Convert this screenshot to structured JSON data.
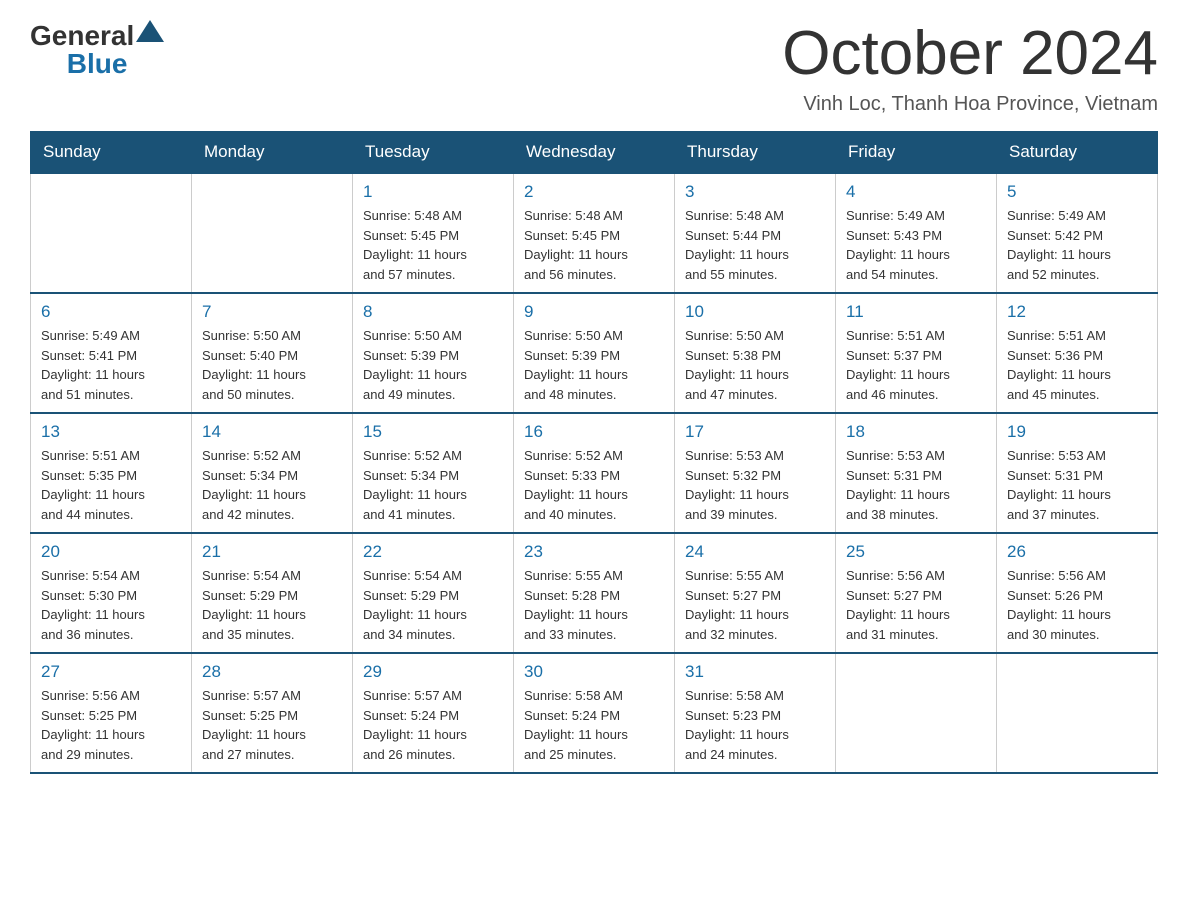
{
  "logo": {
    "general": "General",
    "blue": "Blue"
  },
  "title": "October 2024",
  "location": "Vinh Loc, Thanh Hoa Province, Vietnam",
  "headers": [
    "Sunday",
    "Monday",
    "Tuesday",
    "Wednesday",
    "Thursday",
    "Friday",
    "Saturday"
  ],
  "weeks": [
    [
      {
        "day": "",
        "info": ""
      },
      {
        "day": "",
        "info": ""
      },
      {
        "day": "1",
        "info": "Sunrise: 5:48 AM\nSunset: 5:45 PM\nDaylight: 11 hours\nand 57 minutes."
      },
      {
        "day": "2",
        "info": "Sunrise: 5:48 AM\nSunset: 5:45 PM\nDaylight: 11 hours\nand 56 minutes."
      },
      {
        "day": "3",
        "info": "Sunrise: 5:48 AM\nSunset: 5:44 PM\nDaylight: 11 hours\nand 55 minutes."
      },
      {
        "day": "4",
        "info": "Sunrise: 5:49 AM\nSunset: 5:43 PM\nDaylight: 11 hours\nand 54 minutes."
      },
      {
        "day": "5",
        "info": "Sunrise: 5:49 AM\nSunset: 5:42 PM\nDaylight: 11 hours\nand 52 minutes."
      }
    ],
    [
      {
        "day": "6",
        "info": "Sunrise: 5:49 AM\nSunset: 5:41 PM\nDaylight: 11 hours\nand 51 minutes."
      },
      {
        "day": "7",
        "info": "Sunrise: 5:50 AM\nSunset: 5:40 PM\nDaylight: 11 hours\nand 50 minutes."
      },
      {
        "day": "8",
        "info": "Sunrise: 5:50 AM\nSunset: 5:39 PM\nDaylight: 11 hours\nand 49 minutes."
      },
      {
        "day": "9",
        "info": "Sunrise: 5:50 AM\nSunset: 5:39 PM\nDaylight: 11 hours\nand 48 minutes."
      },
      {
        "day": "10",
        "info": "Sunrise: 5:50 AM\nSunset: 5:38 PM\nDaylight: 11 hours\nand 47 minutes."
      },
      {
        "day": "11",
        "info": "Sunrise: 5:51 AM\nSunset: 5:37 PM\nDaylight: 11 hours\nand 46 minutes."
      },
      {
        "day": "12",
        "info": "Sunrise: 5:51 AM\nSunset: 5:36 PM\nDaylight: 11 hours\nand 45 minutes."
      }
    ],
    [
      {
        "day": "13",
        "info": "Sunrise: 5:51 AM\nSunset: 5:35 PM\nDaylight: 11 hours\nand 44 minutes."
      },
      {
        "day": "14",
        "info": "Sunrise: 5:52 AM\nSunset: 5:34 PM\nDaylight: 11 hours\nand 42 minutes."
      },
      {
        "day": "15",
        "info": "Sunrise: 5:52 AM\nSunset: 5:34 PM\nDaylight: 11 hours\nand 41 minutes."
      },
      {
        "day": "16",
        "info": "Sunrise: 5:52 AM\nSunset: 5:33 PM\nDaylight: 11 hours\nand 40 minutes."
      },
      {
        "day": "17",
        "info": "Sunrise: 5:53 AM\nSunset: 5:32 PM\nDaylight: 11 hours\nand 39 minutes."
      },
      {
        "day": "18",
        "info": "Sunrise: 5:53 AM\nSunset: 5:31 PM\nDaylight: 11 hours\nand 38 minutes."
      },
      {
        "day": "19",
        "info": "Sunrise: 5:53 AM\nSunset: 5:31 PM\nDaylight: 11 hours\nand 37 minutes."
      }
    ],
    [
      {
        "day": "20",
        "info": "Sunrise: 5:54 AM\nSunset: 5:30 PM\nDaylight: 11 hours\nand 36 minutes."
      },
      {
        "day": "21",
        "info": "Sunrise: 5:54 AM\nSunset: 5:29 PM\nDaylight: 11 hours\nand 35 minutes."
      },
      {
        "day": "22",
        "info": "Sunrise: 5:54 AM\nSunset: 5:29 PM\nDaylight: 11 hours\nand 34 minutes."
      },
      {
        "day": "23",
        "info": "Sunrise: 5:55 AM\nSunset: 5:28 PM\nDaylight: 11 hours\nand 33 minutes."
      },
      {
        "day": "24",
        "info": "Sunrise: 5:55 AM\nSunset: 5:27 PM\nDaylight: 11 hours\nand 32 minutes."
      },
      {
        "day": "25",
        "info": "Sunrise: 5:56 AM\nSunset: 5:27 PM\nDaylight: 11 hours\nand 31 minutes."
      },
      {
        "day": "26",
        "info": "Sunrise: 5:56 AM\nSunset: 5:26 PM\nDaylight: 11 hours\nand 30 minutes."
      }
    ],
    [
      {
        "day": "27",
        "info": "Sunrise: 5:56 AM\nSunset: 5:25 PM\nDaylight: 11 hours\nand 29 minutes."
      },
      {
        "day": "28",
        "info": "Sunrise: 5:57 AM\nSunset: 5:25 PM\nDaylight: 11 hours\nand 27 minutes."
      },
      {
        "day": "29",
        "info": "Sunrise: 5:57 AM\nSunset: 5:24 PM\nDaylight: 11 hours\nand 26 minutes."
      },
      {
        "day": "30",
        "info": "Sunrise: 5:58 AM\nSunset: 5:24 PM\nDaylight: 11 hours\nand 25 minutes."
      },
      {
        "day": "31",
        "info": "Sunrise: 5:58 AM\nSunset: 5:23 PM\nDaylight: 11 hours\nand 24 minutes."
      },
      {
        "day": "",
        "info": ""
      },
      {
        "day": "",
        "info": ""
      }
    ]
  ]
}
